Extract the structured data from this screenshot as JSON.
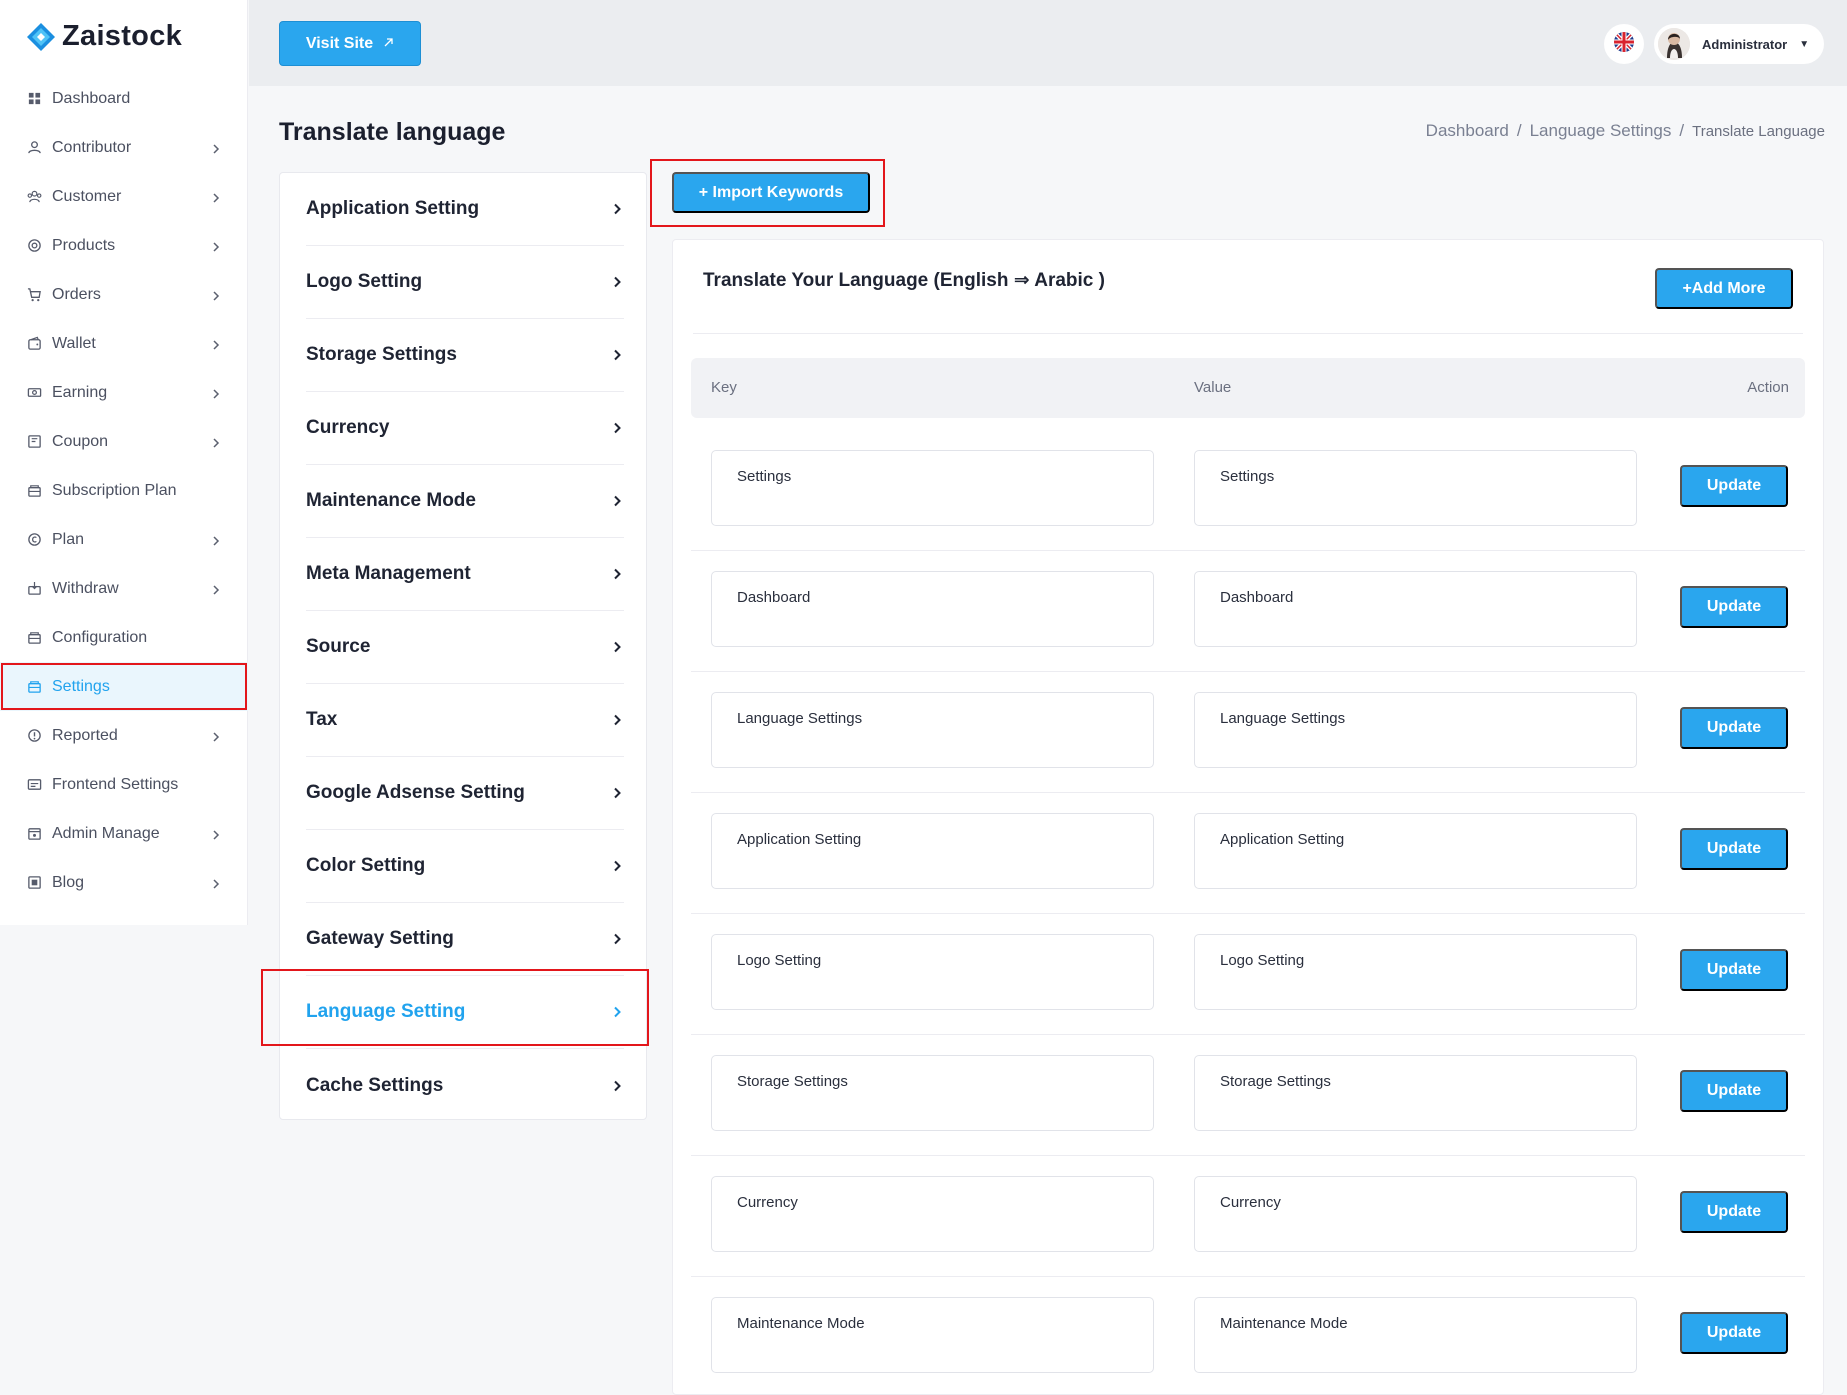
{
  "app": {
    "name": "Zaistock"
  },
  "colors": {
    "primary": "#2aa6ee",
    "highlight": "#e3161b",
    "active_bg": "#eaf6fd"
  },
  "sidebar": {
    "items": [
      {
        "label": "Dashboard",
        "icon": "grid-icon",
        "chevron": false
      },
      {
        "label": "Contributor",
        "icon": "user-icon",
        "chevron": true
      },
      {
        "label": "Customer",
        "icon": "users-icon",
        "chevron": true
      },
      {
        "label": "Products",
        "icon": "product-icon",
        "chevron": true
      },
      {
        "label": "Orders",
        "icon": "cart-icon",
        "chevron": true
      },
      {
        "label": "Wallet",
        "icon": "wallet-icon",
        "chevron": true
      },
      {
        "label": "Earning",
        "icon": "money-icon",
        "chevron": true
      },
      {
        "label": "Coupon",
        "icon": "coupon-icon",
        "chevron": true
      },
      {
        "label": "Subscription Plan",
        "icon": "subscription-icon",
        "chevron": false
      },
      {
        "label": "Plan",
        "icon": "plan-icon",
        "chevron": true
      },
      {
        "label": "Withdraw",
        "icon": "withdraw-icon",
        "chevron": true
      },
      {
        "label": "Configuration",
        "icon": "configuration-icon",
        "chevron": false
      },
      {
        "label": "Settings",
        "icon": "settings-icon",
        "chevron": false,
        "active": true
      },
      {
        "label": "Reported",
        "icon": "report-icon",
        "chevron": true
      },
      {
        "label": "Frontend Settings",
        "icon": "frontend-icon",
        "chevron": false
      },
      {
        "label": "Admin Manage",
        "icon": "admin-icon",
        "chevron": true
      },
      {
        "label": "Blog",
        "icon": "blog-icon",
        "chevron": true
      }
    ]
  },
  "topbar": {
    "visit_site": "Visit Site",
    "user_name": "Administrator",
    "language_flag": "uk-flag-icon"
  },
  "page": {
    "title": "Translate language",
    "breadcrumb": [
      "Dashboard",
      "Language Settings",
      "Translate Language"
    ]
  },
  "settings_menu": {
    "items": [
      {
        "label": "Application Setting"
      },
      {
        "label": "Logo Setting"
      },
      {
        "label": "Storage Settings"
      },
      {
        "label": "Currency"
      },
      {
        "label": "Maintenance Mode"
      },
      {
        "label": "Meta Management"
      },
      {
        "label": "Source"
      },
      {
        "label": "Tax"
      },
      {
        "label": "Google Adsense Setting"
      },
      {
        "label": "Color Setting"
      },
      {
        "label": "Gateway Setting"
      },
      {
        "label": "Language Setting",
        "active": true
      },
      {
        "label": "Cache Settings"
      }
    ]
  },
  "import_keywords": "+ Import Keywords",
  "translate_panel": {
    "title": "Translate Your Language (English ⇒ Arabic )",
    "add_more": "+Add More",
    "columns": {
      "key": "Key",
      "value": "Value",
      "action": "Action"
    },
    "update_label": "Update",
    "rows": [
      {
        "key": "Settings",
        "value": "Settings"
      },
      {
        "key": "Dashboard",
        "value": "Dashboard"
      },
      {
        "key": "Language Settings",
        "value": "Language Settings"
      },
      {
        "key": "Application Setting",
        "value": "Application Setting"
      },
      {
        "key": "Logo Setting",
        "value": "Logo Setting"
      },
      {
        "key": "Storage Settings",
        "value": "Storage Settings"
      },
      {
        "key": "Currency",
        "value": "Currency"
      },
      {
        "key": "Maintenance Mode",
        "value": "Maintenance Mode"
      }
    ]
  }
}
